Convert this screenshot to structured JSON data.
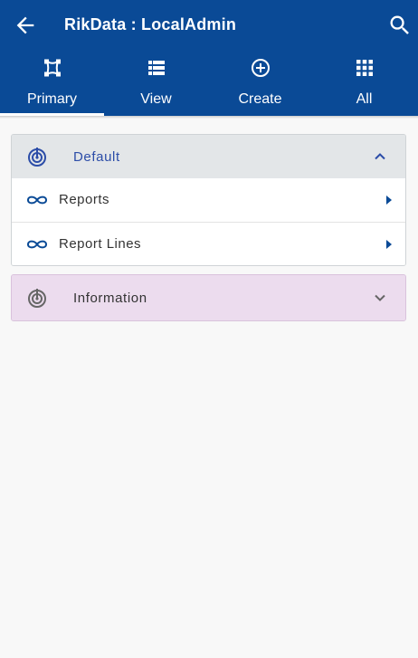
{
  "header": {
    "title": "RikData : LocalAdmin"
  },
  "tabs": [
    {
      "label": "Primary",
      "icon": "primary-shape-icon",
      "active": true
    },
    {
      "label": "View",
      "icon": "list-view-icon"
    },
    {
      "label": "Create",
      "icon": "add-circle-icon"
    },
    {
      "label": "All",
      "icon": "apps-grid-icon"
    }
  ],
  "sections": [
    {
      "title": "Default",
      "expanded": true,
      "items": [
        {
          "label": "Reports"
        },
        {
          "label": "Report Lines"
        }
      ]
    },
    {
      "title": "Information",
      "expanded": false
    }
  ],
  "colors": {
    "appbar": "#0a4a96",
    "accent": "#2c4da8",
    "section_header": "#e3e6e8",
    "info_section": "#ecdcee"
  }
}
